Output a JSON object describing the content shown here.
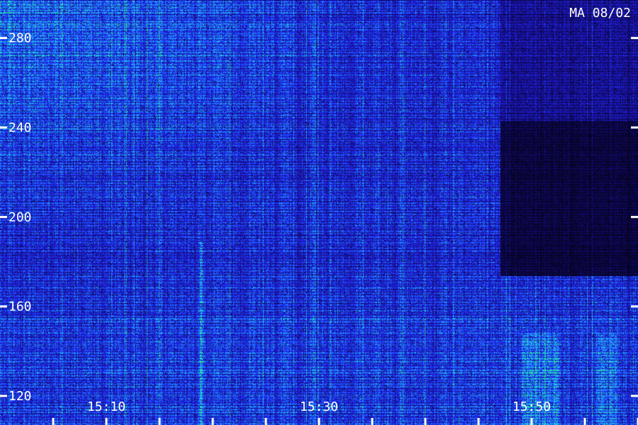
{
  "header": {
    "station_label": "MA 08/02"
  },
  "chart_data": {
    "type": "heatmap",
    "title": "",
    "xlabel": "",
    "ylabel": "",
    "x_ticks": [
      {
        "value": "15:10",
        "pos": 0.1667
      },
      {
        "value": "15:30",
        "pos": 0.5
      },
      {
        "value": "15:50",
        "pos": 0.8333
      }
    ],
    "x_minor_tick_count": 12,
    "y_ticks": [
      120,
      160,
      200,
      240,
      280
    ],
    "ylim": [
      107,
      297
    ],
    "colormap": [
      "#000000",
      "#1a10a0",
      "#2030ff",
      "#20a0ff",
      "#20e0e0",
      "#30ff60"
    ],
    "grid": false,
    "legend": "none"
  }
}
